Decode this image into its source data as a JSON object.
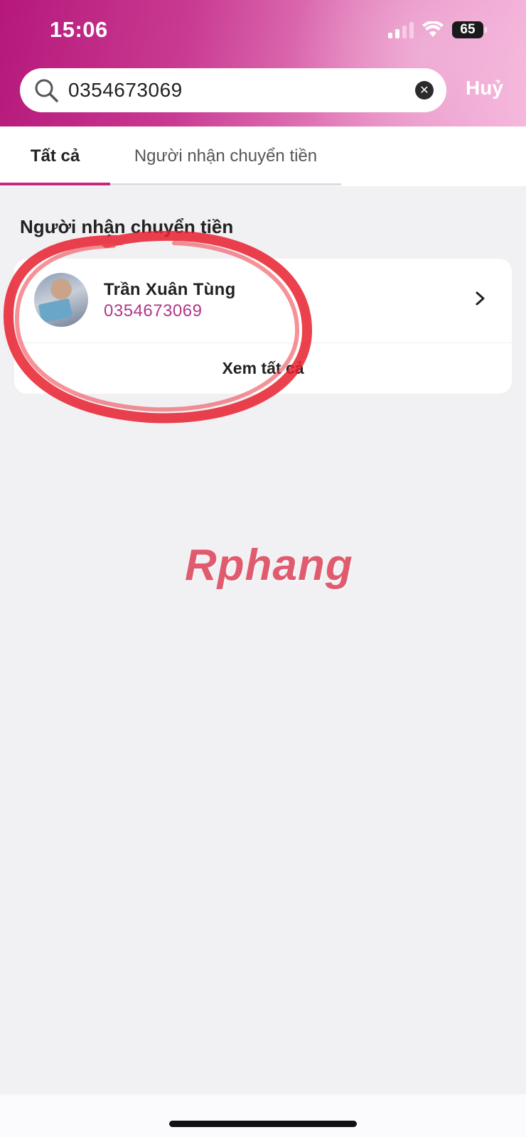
{
  "status_bar": {
    "time": "15:06",
    "battery": "65"
  },
  "search": {
    "value": "0354673069",
    "placeholder": "",
    "cancel_label": "Huỷ"
  },
  "tabs": [
    {
      "label": "Tất cả",
      "active": true
    },
    {
      "label": "Người nhận chuyển tiền",
      "active": false
    }
  ],
  "section": {
    "title": "Người nhận chuyển tiền",
    "contact": {
      "name": "Trần Xuân Tùng",
      "phone": "0354673069"
    },
    "see_all_label": "Xem tất cả"
  },
  "watermark": {
    "text": "Rphang"
  },
  "colors": {
    "accent": "#c2287f",
    "phone_text": "#b2378a",
    "header_start": "#b5187a",
    "header_end": "#f6b8dd",
    "annotation": "#e8202e",
    "background": "#f1f1f4"
  },
  "icons": {
    "search": "search-icon",
    "clear": "clear-icon",
    "chevron": "chevron-right-icon",
    "wifi": "wifi-icon",
    "signal": "signal-icon",
    "battery": "battery-icon"
  }
}
